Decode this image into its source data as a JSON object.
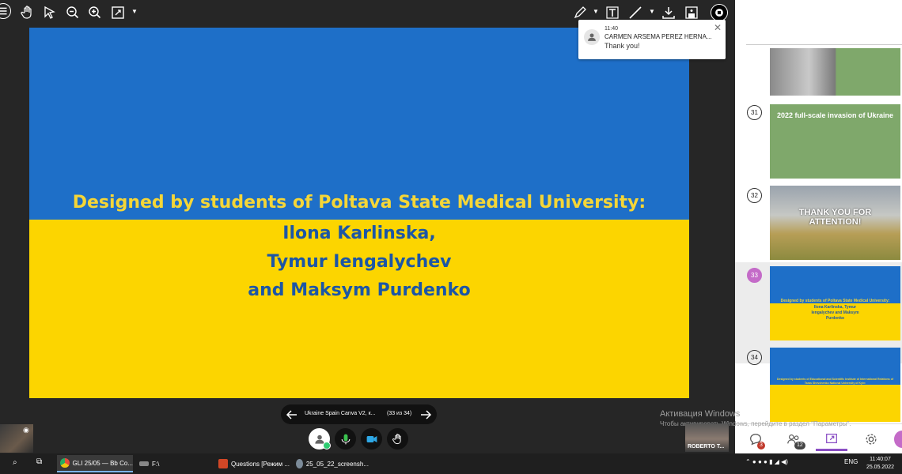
{
  "toolbar": {
    "menu_icon": "menu-icon",
    "tools": [
      "hand-icon",
      "pointer-icon",
      "zoom-out-icon",
      "zoom-in-icon",
      "fit-icon"
    ],
    "right_tools": [
      "pen-icon",
      "text-icon",
      "line-icon",
      "download-icon",
      "save-icon",
      "stop-icon"
    ]
  },
  "slide": {
    "line1": "Designed by students of Poltava State Medical University:",
    "name1": "Ilona Karlinska,",
    "name2": "Tymur Iengalychev",
    "name3": "and Maksym Purdenko",
    "colors": {
      "blue": "#1e6fc8",
      "yellow": "#fcd500"
    }
  },
  "notification": {
    "time": "11:40",
    "sender": "CARMEN ARSEMA PEREZ HERNA...",
    "message": "Thank you!"
  },
  "panel": {
    "thumbnails": [
      {
        "number": "31",
        "title": "2022 full-scale invasion of Ukraine"
      },
      {
        "number": "32",
        "title": "THANK YOU FOR ATTENTION!"
      },
      {
        "number": "33",
        "line1": "Designed by students of Poltava State Medical University:",
        "names": "Ilona Karlinska, Tymur Iengalychev and Maksym Purdenko"
      },
      {
        "number": "34",
        "text": "Designed by students of Educational and Scientific Institute of International Relations of Taras Shevchenko National University of Kyiv:"
      }
    ],
    "badges": {
      "chat": "3",
      "participants": "12"
    }
  },
  "nav": {
    "title": "Ukraine Spain Canva V2, к...",
    "page": "(33 из 34)"
  },
  "remote": {
    "name": "ROBERTO T..."
  },
  "watermark": {
    "title": "Активация Windows",
    "subtitle": "Чтобы активировать Windows, перейдите в раздел \"Параметры\"."
  },
  "taskbar": {
    "apps": [
      {
        "label": "GLI 25/05 — Bb Co..."
      },
      {
        "label": "F:\\"
      },
      {
        "label": "Questions [Режим ..."
      },
      {
        "label": "25_05_22_screensh..."
      }
    ],
    "lang": "ENG",
    "time": "11:40:07",
    "date": "25.05.2022"
  }
}
